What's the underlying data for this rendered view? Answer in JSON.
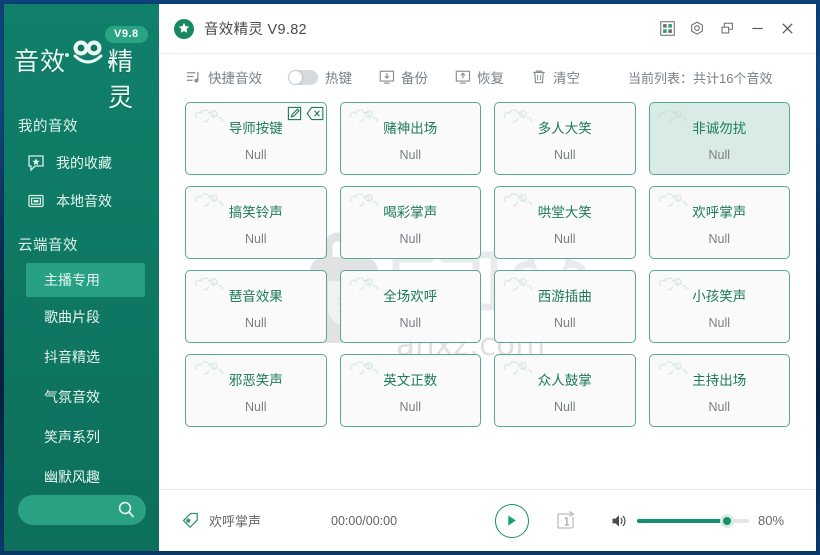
{
  "window": {
    "title": "音效精灵 V9.82",
    "controls": {
      "apps_label": "apps",
      "settings_label": "settings",
      "restore_label": "restore",
      "minimize_label": "minimize",
      "close_label": "close"
    }
  },
  "sidebar": {
    "logo": {
      "text_left": "音效",
      "text_right": "精灵",
      "version_badge": "V9.8"
    },
    "my_sound_title": "我的音效",
    "my_items": [
      {
        "label": "我的收藏",
        "icon": "favorite-star-icon"
      },
      {
        "label": "本地音效",
        "icon": "local-folder-icon"
      }
    ],
    "cloud_title": "云端音效",
    "cloud_items": [
      {
        "label": "主播专用",
        "active": true
      },
      {
        "label": "歌曲片段",
        "active": false
      },
      {
        "label": "抖音精选",
        "active": false
      },
      {
        "label": "气氛音效",
        "active": false
      },
      {
        "label": "笑声系列",
        "active": false
      },
      {
        "label": "幽默风趣",
        "active": false
      }
    ],
    "search": {
      "placeholder": "",
      "value": "",
      "icon": "search-icon"
    }
  },
  "toolbar": {
    "quick_sound": {
      "label": "快捷音效",
      "icon": "playlist-icon"
    },
    "hotkey": {
      "label": "热键",
      "enabled": false
    },
    "backup": {
      "label": "备份",
      "icon": "backup-icon"
    },
    "restore": {
      "label": "恢复",
      "icon": "restore-icon"
    },
    "clear": {
      "label": "清空",
      "icon": "trash-icon"
    },
    "count_text": "当前列表：共计16个音效"
  },
  "grid": {
    "card_actions": {
      "edit": "edit-icon",
      "delete": "delete-icon"
    },
    "cards": [
      {
        "name": "导师按键",
        "value": "Null",
        "selected": false,
        "actions": true
      },
      {
        "name": "赌神出场",
        "value": "Null",
        "selected": false,
        "actions": false
      },
      {
        "name": "多人大笑",
        "value": "Null",
        "selected": false,
        "actions": false
      },
      {
        "name": "非诚勿扰",
        "value": "Null",
        "selected": true,
        "actions": false
      },
      {
        "name": "搞笑铃声",
        "value": "Null",
        "selected": false,
        "actions": false
      },
      {
        "name": "喝彩掌声",
        "value": "Null",
        "selected": false,
        "actions": false
      },
      {
        "name": "哄堂大笑",
        "value": "Null",
        "selected": false,
        "actions": false
      },
      {
        "name": "欢呼掌声",
        "value": "Null",
        "selected": false,
        "actions": false
      },
      {
        "name": "琶音效果",
        "value": "Null",
        "selected": false,
        "actions": false
      },
      {
        "name": "全场欢呼",
        "value": "Null",
        "selected": false,
        "actions": false
      },
      {
        "name": "西游插曲",
        "value": "Null",
        "selected": false,
        "actions": false
      },
      {
        "name": "小孩笑声",
        "value": "Null",
        "selected": false,
        "actions": false
      },
      {
        "name": "邪恶笑声",
        "value": "Null",
        "selected": false,
        "actions": false
      },
      {
        "name": "英文正数",
        "value": "Null",
        "selected": false,
        "actions": false
      },
      {
        "name": "众人鼓掌",
        "value": "Null",
        "selected": false,
        "actions": false
      },
      {
        "name": "主持出场",
        "value": "Null",
        "selected": false,
        "actions": false
      }
    ]
  },
  "watermark": {
    "cn_text": "安下载",
    "url_text": "anxz.com"
  },
  "player": {
    "current_track": "欢呼掌声",
    "time": "00:00/00:00",
    "play_icon": "play-icon",
    "loop_mode_label": "1",
    "volume_percent": "80%",
    "volume_value": 80,
    "volume_icon": "volume-icon"
  },
  "colors": {
    "sidebar_green": "#0e7762",
    "accent_green": "#27a085",
    "card_border": "#5aa793",
    "card_selected_bg": "#d9ebe6",
    "card_title": "#1d7a5c",
    "player_green": "#13916c",
    "frame_blue": "#0d3f78"
  }
}
